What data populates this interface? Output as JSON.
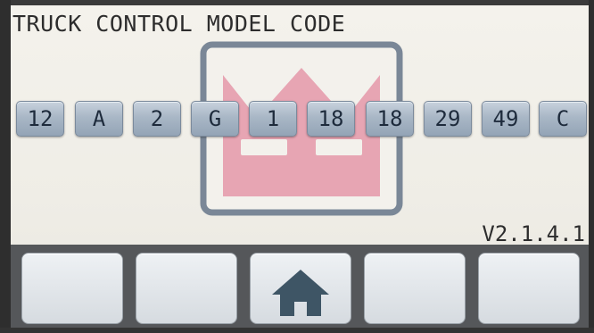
{
  "header": {
    "title": "TRUCK CONTROL MODEL CODE"
  },
  "model_code": [
    {
      "label": "12"
    },
    {
      "label": "A"
    },
    {
      "label": "2"
    },
    {
      "label": "G"
    },
    {
      "label": "1"
    },
    {
      "label": "18"
    },
    {
      "label": "18"
    },
    {
      "label": "29"
    },
    {
      "label": "49"
    },
    {
      "label": "C"
    }
  ],
  "version": "V2.1.4.1",
  "softkeys": [
    {
      "label": "",
      "icon": ""
    },
    {
      "label": "",
      "icon": ""
    },
    {
      "label": "",
      "icon": "home-icon"
    },
    {
      "label": "",
      "icon": ""
    },
    {
      "label": "",
      "icon": ""
    }
  ],
  "colors": {
    "crown": "#e7a5b3",
    "logo_frame": "#7a8797",
    "chip_text": "#1e2b3c",
    "home_icon": "#3e5565"
  }
}
